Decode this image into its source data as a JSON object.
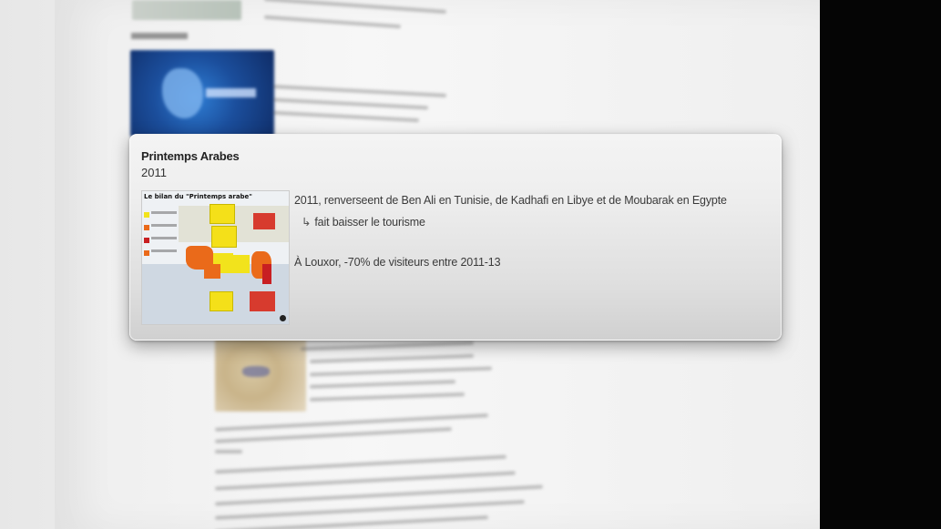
{
  "card": {
    "title": "Printemps Arabes",
    "subtitle": "2011",
    "image": {
      "heading": "Le bilan du \"Printemps arabe\""
    },
    "lines": [
      "2011, renverseent de Ben Ali en Tunisie, de Kadhafi en Libye et de Moubarak en Egypte",
      "fait baisser le tourisme",
      "À Louxor, -70% de visiteurs entre 2011-13"
    ],
    "arrow_glyph": "↳"
  },
  "colors": {
    "card_bg": "#eeeeee",
    "text": "#3a3a3a",
    "map_yellow": "#f2e31c",
    "map_orange": "#ea6a1a",
    "map_red": "#c81f22"
  }
}
